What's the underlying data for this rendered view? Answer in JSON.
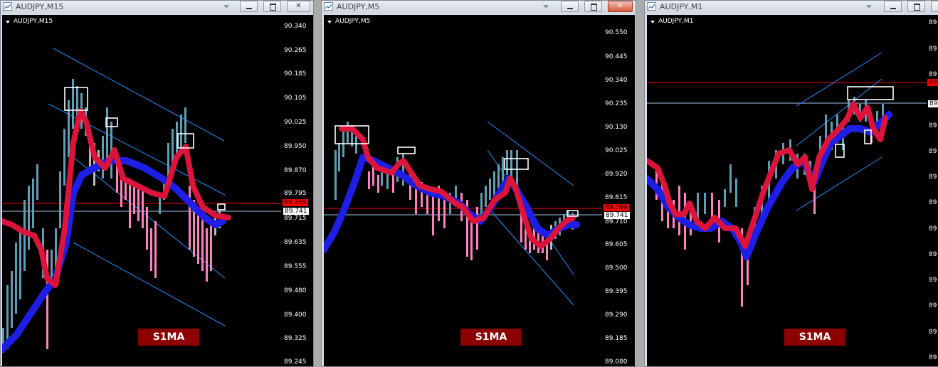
{
  "windows": [
    {
      "title": "AUDJPY,M15",
      "chart_label": "AUDJPY,M15",
      "price_ticks": [
        "90.340",
        "90.265",
        "90.185",
        "90.105",
        "90.025",
        "89.950",
        "89.870",
        "89.795",
        "89.741",
        "89.715",
        "89.635",
        "89.555",
        "89.480",
        "89.400",
        "89.325",
        "89.245"
      ],
      "price_red": "89.769",
      "price_white": "89.741",
      "brand": "S1MA"
    },
    {
      "title": "AUDJPY,M5",
      "chart_label": "AUDJPY,M5",
      "price_ticks": [
        "90.550",
        "90.445",
        "90.340",
        "90.235",
        "90.130",
        "90.025",
        "89.920",
        "89.815",
        "89.741",
        "89.710",
        "89.605",
        "89.500",
        "89.395",
        "89.290",
        "89.185",
        "89.080"
      ],
      "price_red": "89.769",
      "price_white": "89.741",
      "brand": "S1MA"
    },
    {
      "title": "AUDJPY,M1",
      "chart_label": "AUDJPY,M1",
      "price_ticks": [
        "89",
        "89",
        "89",
        "89",
        "89",
        "89",
        "89",
        "89",
        "89",
        "89",
        "89",
        "89",
        "89",
        "89",
        "89"
      ],
      "price_red": "89",
      "price_white": "89",
      "brand": "S1MA"
    }
  ],
  "colors": {
    "background": "#000000",
    "fast_ma": "#dc143c",
    "slow_ma": "#1e1ee6",
    "bull_candle": "#5f9fb5",
    "bear_candle": "#ff80c0",
    "channel": "#1e90ff",
    "bid_line": "#ff0000",
    "ask_line": "#9fc4e8"
  },
  "icons": [
    "chart-app-icon",
    "minimize-icon",
    "maximize-icon",
    "close-icon",
    "dropdown-icon"
  ]
}
